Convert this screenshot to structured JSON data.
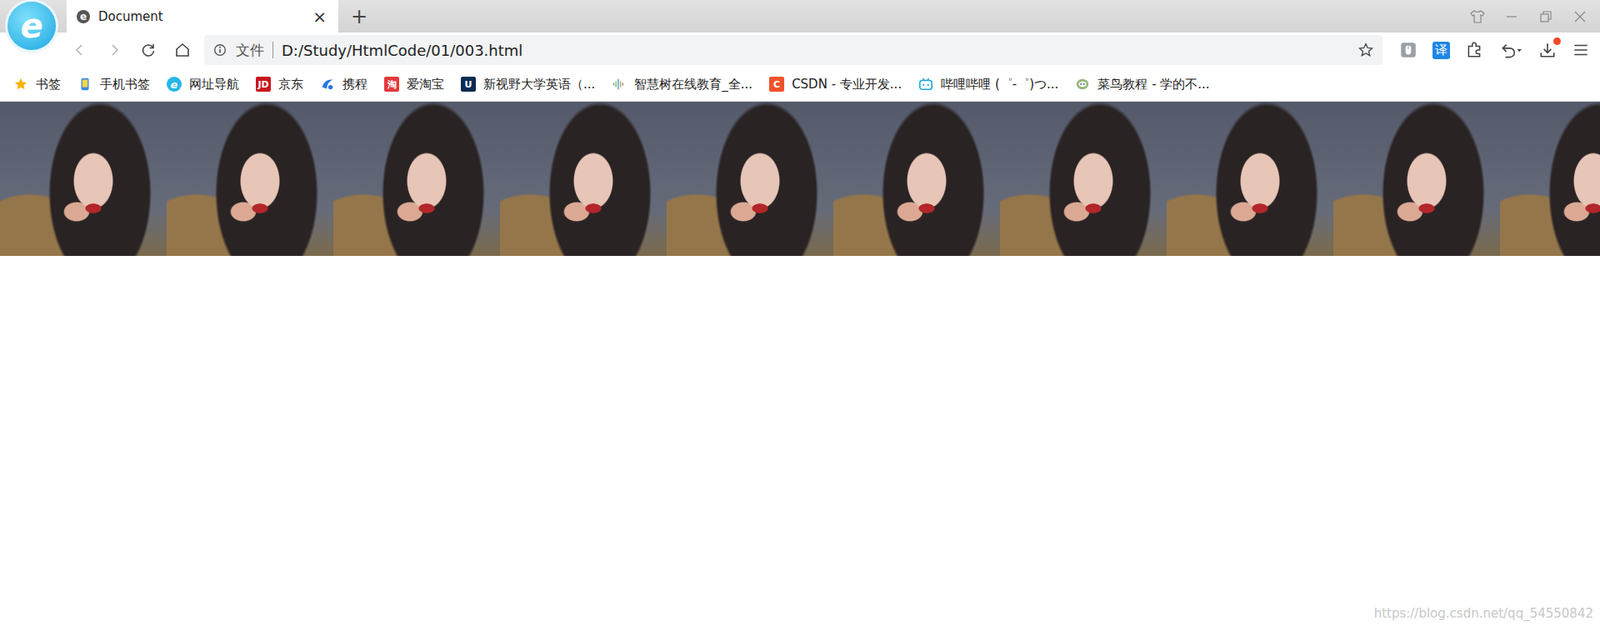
{
  "window": {
    "logo": "e"
  },
  "tabs": [
    {
      "label": "Document",
      "favicon": "e",
      "close": "×",
      "selected": true
    }
  ],
  "new_tab": "+",
  "nav": {
    "back_enabled": false,
    "forward_enabled": false
  },
  "address_bar": {
    "scheme_label": "文件",
    "url": "D:/Study/HtmlCode/01/003.html",
    "bookmarked": false
  },
  "toolbar": {
    "translate": "译",
    "download_badge": true
  },
  "bookmarks": [
    {
      "label": "书签",
      "kind": "star"
    },
    {
      "label": "手机书签",
      "kind": "phone"
    },
    {
      "label": "网址导航",
      "kind": "nav",
      "badge": "e",
      "color": "#27b6e8"
    },
    {
      "label": "京东",
      "kind": "badge",
      "badge": "JD",
      "color": "#c9151e"
    },
    {
      "label": "携程",
      "kind": "ctrip"
    },
    {
      "label": "爱淘宝",
      "kind": "badge",
      "badge": "淘",
      "color": "#e4393c"
    },
    {
      "label": "新视野大学英语（...",
      "kind": "badge",
      "badge": "U",
      "color": "#0d2b52"
    },
    {
      "label": "智慧树在线教育_全...",
      "kind": "bars"
    },
    {
      "label": "CSDN - 专业开发...",
      "kind": "badge",
      "badge": "C",
      "color": "#f0522a"
    },
    {
      "label": "哔哩哔哩 (゜-゜)つ...",
      "kind": "bilibili"
    },
    {
      "label": "菜鸟教程 - 学的不...",
      "kind": "runoob"
    }
  ],
  "page": {
    "watermark": "https://blog.csdn.net/qq_54550842"
  }
}
